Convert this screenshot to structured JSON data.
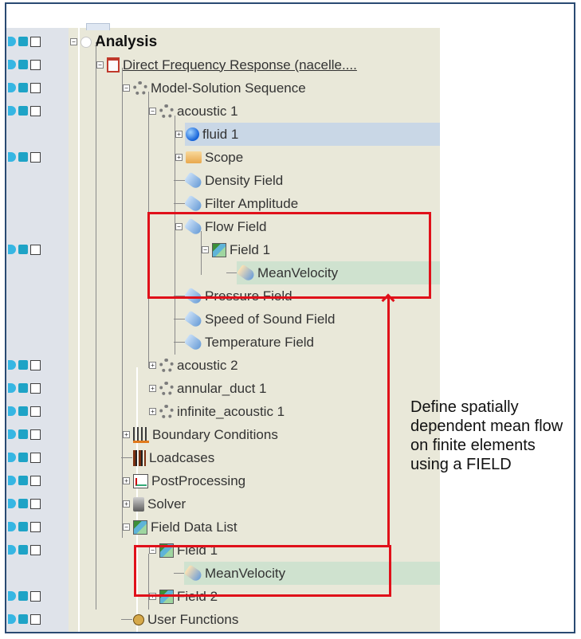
{
  "tree": [
    {
      "label": "Analysis",
      "level": 0,
      "toggle": "−",
      "vis": true,
      "icon": "analysis-icon",
      "style": "bold"
    },
    {
      "label": "Direct Frequency Response (nacelle....",
      "level": 1,
      "toggle": "−",
      "vis": true,
      "icon": "document-icon",
      "style": "link"
    },
    {
      "label": "Model-Solution Sequence",
      "level": 2,
      "toggle": "−",
      "vis": true,
      "icon": "gear-icon"
    },
    {
      "label": "acoustic 1",
      "level": 3,
      "toggle": "−",
      "vis": true,
      "icon": "gear-icon"
    },
    {
      "label": "fluid 1",
      "level": 4,
      "toggle": "+",
      "vis": false,
      "icon": "sphere-icon",
      "selected": true
    },
    {
      "label": "Scope",
      "level": 4,
      "toggle": "+",
      "vis": true,
      "icon": "folder-icon"
    },
    {
      "label": "Density Field",
      "level": 4,
      "toggle": "",
      "vis": false,
      "icon": "tag-icon"
    },
    {
      "label": "Filter Amplitude",
      "level": 4,
      "toggle": "",
      "vis": false,
      "icon": "tag-icon"
    },
    {
      "label": "Flow Field",
      "level": 4,
      "toggle": "−",
      "vis": false,
      "icon": "tag-icon"
    },
    {
      "label": "Field 1",
      "level": 5,
      "toggle": "−",
      "vis": true,
      "icon": "field-icon"
    },
    {
      "label": "MeanVelocity",
      "level": 6,
      "toggle": "",
      "vis": false,
      "icon": "tag-icon",
      "highlight": true
    },
    {
      "label": "Pressure Field",
      "level": 4,
      "toggle": "",
      "vis": false,
      "icon": "tag-icon"
    },
    {
      "label": "Speed of Sound Field",
      "level": 4,
      "toggle": "",
      "vis": false,
      "icon": "tag-icon"
    },
    {
      "label": "Temperature Field",
      "level": 4,
      "toggle": "",
      "vis": false,
      "icon": "tag-icon"
    },
    {
      "label": "acoustic 2",
      "level": 3,
      "toggle": "+",
      "vis": true,
      "icon": "gear-icon"
    },
    {
      "label": "annular_duct 1",
      "level": 3,
      "toggle": "+",
      "vis": true,
      "icon": "gear-icon"
    },
    {
      "label": "infinite_acoustic 1",
      "level": 3,
      "toggle": "+",
      "vis": true,
      "icon": "gear-icon"
    },
    {
      "label": "Boundary Conditions",
      "level": 2,
      "toggle": "+",
      "vis": true,
      "icon": "boundary-conditions-icon"
    },
    {
      "label": "Loadcases",
      "level": 2,
      "toggle": "",
      "vis": true,
      "icon": "loadcases-icon"
    },
    {
      "label": "PostProcessing",
      "level": 2,
      "toggle": "+",
      "vis": true,
      "icon": "postprocessing-icon"
    },
    {
      "label": "Solver",
      "level": 2,
      "toggle": "+",
      "vis": true,
      "icon": "solver-icon"
    },
    {
      "label": "Field Data List",
      "level": 2,
      "toggle": "−",
      "vis": true,
      "icon": "field-icon"
    },
    {
      "label": "Field 1",
      "level": 3,
      "toggle": "−",
      "vis": true,
      "icon": "field-icon"
    },
    {
      "label": "MeanVelocity",
      "level": 4,
      "toggle": "",
      "vis": false,
      "icon": "tag-icon",
      "highlight": true
    },
    {
      "label": "Field 2",
      "level": 3,
      "toggle": "+",
      "vis": true,
      "icon": "field-icon"
    },
    {
      "label": "User Functions",
      "level": 2,
      "toggle": "",
      "vis": true,
      "icon": "user-functions-icon"
    }
  ],
  "annotation": {
    "text": "Define spatially dependent mean flow on finite elements using a FIELD"
  },
  "colors": {
    "highlight_box": "#e0101a",
    "selected_row": "#c9d7e6",
    "highlight_row": "#cfe2cf"
  }
}
